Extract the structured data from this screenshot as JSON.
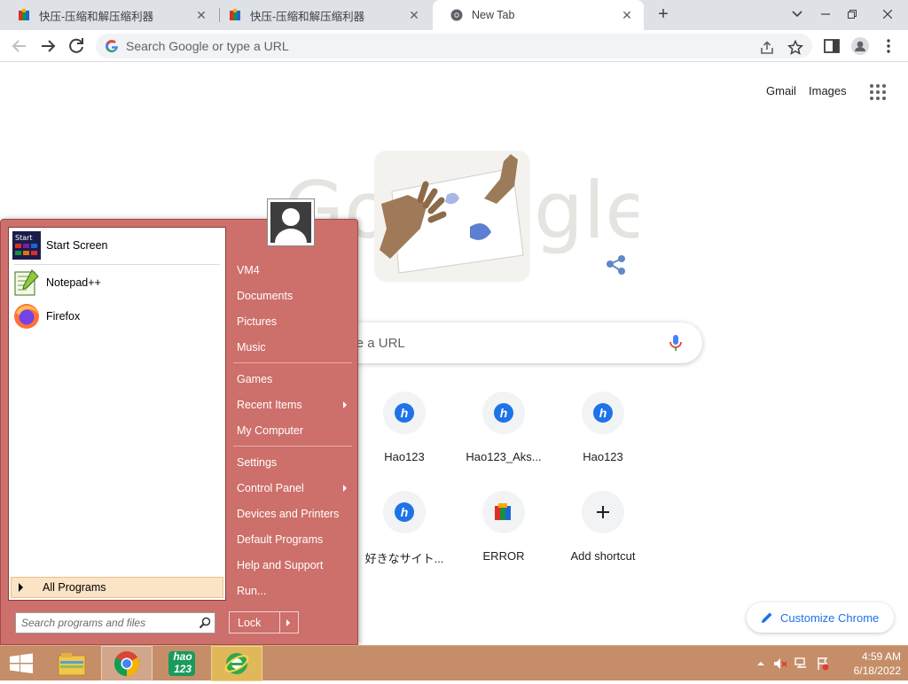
{
  "browser": {
    "tabs": [
      {
        "label": "快压-压缩和解压缩利器",
        "icon": "kuaiya-icon"
      },
      {
        "label": "快压-压缩和解压缩利器",
        "icon": "kuaiya-icon"
      },
      {
        "label": "New Tab",
        "icon": "chrome-icon",
        "active": true
      }
    ],
    "omnibox_placeholder": "Search Google or type a URL"
  },
  "ntp": {
    "top_links": {
      "gmail": "Gmail",
      "images": "Images"
    },
    "search_placeholder": "Search Google or type a URL",
    "doodle_text": "Google",
    "shortcuts": [
      {
        "title": "Hao123",
        "icon": "hao123-icon"
      },
      {
        "title": "Hao123_Aks...",
        "icon": "hao123-icon"
      },
      {
        "title": "Hao123",
        "icon": "hao123-icon"
      },
      {
        "title": "好きなサイト...",
        "icon": "hao123-icon"
      },
      {
        "title": "ERROR",
        "icon": "winrar-icon"
      },
      {
        "title": "Add shortcut",
        "icon": "plus-icon"
      }
    ],
    "customize_label": "Customize Chrome"
  },
  "start_menu": {
    "pinned": [
      {
        "label": "Start Screen",
        "icon": "start-screen-icon"
      },
      {
        "label": "Notepad++",
        "icon": "notepadpp-icon"
      },
      {
        "label": "Firefox",
        "icon": "firefox-icon"
      }
    ],
    "all_programs": "All Programs",
    "search_placeholder": "Search programs and files",
    "right_items": [
      {
        "label": "VM4"
      },
      {
        "label": "Documents"
      },
      {
        "label": "Pictures"
      },
      {
        "label": "Music"
      },
      {
        "label": "Games"
      },
      {
        "label": "Recent Items",
        "submenu": true
      },
      {
        "label": "My Computer"
      },
      {
        "label": "Settings"
      },
      {
        "label": "Control Panel",
        "submenu": true
      },
      {
        "label": "Devices and Printers"
      },
      {
        "label": "Default Programs"
      },
      {
        "label": "Help and Support"
      },
      {
        "label": "Run..."
      }
    ],
    "lock_label": "Lock"
  },
  "taskbar": {
    "apps": [
      {
        "name": "file-explorer-icon"
      },
      {
        "name": "chrome-icon"
      },
      {
        "name": "hao123-icon",
        "text": "hao 123"
      },
      {
        "name": "ie-icon"
      }
    ],
    "clock": {
      "time": "4:59 AM",
      "date": "6/18/2022"
    }
  },
  "colors": {
    "start_menu_bg": "#cd6f6a",
    "taskbar_bg": "#c58e69",
    "chrome_accent": "#1a73e8"
  }
}
